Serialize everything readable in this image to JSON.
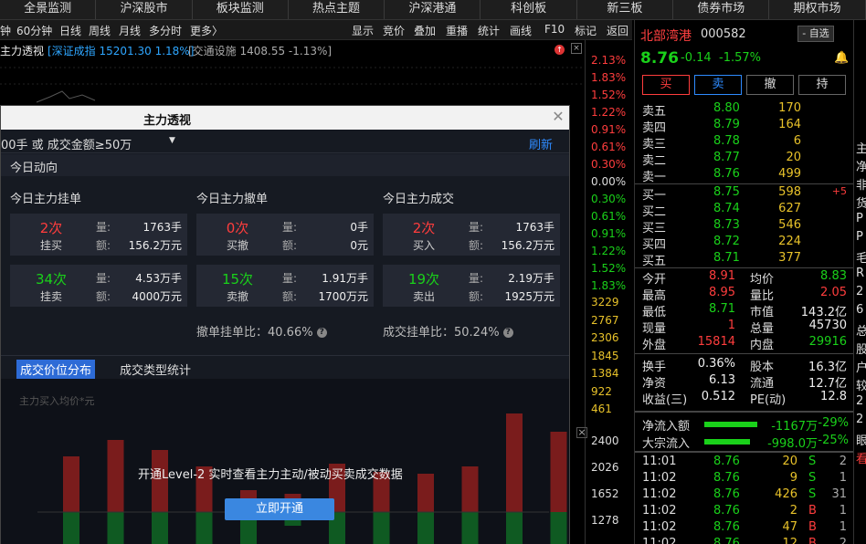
{
  "topnav": [
    "全景监测",
    "沪深股市",
    "板块监测",
    "热点主题",
    "沪深港通",
    "科创板",
    "新三板",
    "债券市场",
    "期权市场"
  ],
  "toolbar": {
    "periods": [
      "钟",
      "60分钟",
      "日线",
      "周线",
      "月线",
      "多分时",
      "更多〉"
    ],
    "tools": [
      "显示",
      "竞价",
      "叠加",
      "重播",
      "统计",
      "画线",
      "F10",
      "标记",
      "返回"
    ]
  },
  "chartinfo": {
    "title": "主力透视",
    "index": "[深证成指 15201.30 1.18%]",
    "sector": "[交通设施 1408.55 -1.13%]"
  },
  "rscale": {
    "pct_up": [
      "2.13%",
      "1.83%",
      "1.52%",
      "1.22%",
      "0.91%",
      "0.61%",
      "0.30%",
      "0.00%"
    ],
    "pct_dn": [
      "0.30%",
      "0.61%",
      "0.91%",
      "1.22%",
      "1.52%",
      "1.83%"
    ],
    "vol": [
      "3229",
      "2767",
      "2306",
      "1845",
      "1384",
      "922",
      "461"
    ],
    "lower": [
      "2400",
      "2026",
      "1652",
      "1278"
    ],
    "close_mark": "×"
  },
  "stock": {
    "name": "北部湾港",
    "code": "000582",
    "selfsel": "- 自选",
    "price": "8.76",
    "chg": "-0.14",
    "chgpct": "-1.57%",
    "buttons": [
      "买",
      "卖",
      "撤",
      "持"
    ],
    "sells": [
      {
        "l": "卖五",
        "p": "8.80",
        "v": "170"
      },
      {
        "l": "卖四",
        "p": "8.79",
        "v": "164"
      },
      {
        "l": "卖三",
        "p": "8.78",
        "v": "6"
      },
      {
        "l": "卖二",
        "p": "8.77",
        "v": "20"
      },
      {
        "l": "卖一",
        "p": "8.76",
        "v": "499"
      }
    ],
    "buys": [
      {
        "l": "买一",
        "p": "8.75",
        "v": "598",
        "x": "+5"
      },
      {
        "l": "买二",
        "p": "8.74",
        "v": "627",
        "x": ""
      },
      {
        "l": "买三",
        "p": "8.73",
        "v": "546",
        "x": ""
      },
      {
        "l": "买四",
        "p": "8.72",
        "v": "224",
        "x": ""
      },
      {
        "l": "买五",
        "p": "8.71",
        "v": "377",
        "x": ""
      }
    ],
    "stats": [
      {
        "a": "今开",
        "b": "8.91",
        "c": "均价",
        "d": "8.83"
      },
      {
        "a": "最高",
        "b": "8.95",
        "c": "量比",
        "d": "2.05"
      },
      {
        "a": "最低",
        "b": "8.71",
        "c": "市值",
        "d": "143.2亿"
      },
      {
        "a": "现量",
        "b": "1",
        "c": "总量",
        "d": "45730"
      },
      {
        "a": "外盘",
        "b": "15814",
        "c": "内盘",
        "d": "29916"
      }
    ],
    "stats2": [
      {
        "a": "换手",
        "b": "0.36%",
        "c": "股本",
        "d": "16.3亿"
      },
      {
        "a": "净资",
        "b": "6.13",
        "c": "流通",
        "d": "12.7亿"
      },
      {
        "a": "收益(三)",
        "b": "0.512",
        "c": "PE(动)",
        "d": "12.8"
      }
    ],
    "flows": [
      {
        "l": "净流入额",
        "v": "-1167万",
        "p": "-29%",
        "fill": 0.29
      },
      {
        "l": "大宗流入",
        "v": "-998.0万",
        "p": "-25%",
        "fill": 0.25
      }
    ],
    "ticks": [
      {
        "t": "11:01",
        "p": "8.76",
        "v": "20",
        "s": "S",
        "n": "2"
      },
      {
        "t": "11:02",
        "p": "8.76",
        "v": "9",
        "s": "S",
        "n": "1"
      },
      {
        "t": "11:02",
        "p": "8.76",
        "v": "426",
        "s": "S",
        "n": "31"
      },
      {
        "t": "11:02",
        "p": "8.76",
        "v": "2",
        "s": "B",
        "n": "1"
      },
      {
        "t": "11:02",
        "p": "8.76",
        "v": "47",
        "s": "B",
        "n": "1"
      },
      {
        "t": "11:02",
        "p": "8.76",
        "v": "12",
        "s": "B",
        "n": "2"
      }
    ]
  },
  "farright": [
    "主",
    "净",
    "非",
    "货",
    "P",
    "P",
    "毛",
    "R",
    "2",
    "6",
    "总",
    "股",
    "户",
    "较",
    "2",
    "2",
    "眼",
    "看"
  ],
  "modal": {
    "title": "主力透视",
    "filter": "00手 或 成交金额≥50万",
    "refresh": "刷新",
    "section": "今日动向",
    "groups": [
      {
        "head": "今日主力挂单",
        "cards": [
          {
            "big": "2次",
            "sm": "挂买",
            "q": "1763手",
            "a": "156.2万元",
            "c": "red"
          },
          {
            "big": "34次",
            "sm": "挂卖",
            "q": "4.53万手",
            "a": "4000万元",
            "c": "green"
          }
        ]
      },
      {
        "head": "今日主力撤单",
        "cards": [
          {
            "big": "0次",
            "sm": "买撤",
            "q": "0手",
            "a": "0元",
            "c": "red"
          },
          {
            "big": "15次",
            "sm": "卖撤",
            "q": "1.91万手",
            "a": "1700万元",
            "c": "green"
          }
        ]
      },
      {
        "head": "今日主力成交",
        "cards": [
          {
            "big": "2次",
            "sm": "买入",
            "q": "1763手",
            "a": "156.2万元",
            "c": "red"
          },
          {
            "big": "19次",
            "sm": "卖出",
            "q": "2.19万手",
            "a": "1925万元",
            "c": "green"
          }
        ]
      }
    ],
    "qlabel": "量:",
    "alabel": "额:",
    "ratio1": "撤单挂单比：40.66%",
    "ratio2": "成交挂单比：50.24%",
    "tabs": [
      "成交价位分布",
      "成交类型统计"
    ],
    "chartlabel": "主力买入均价*元",
    "overlay": "开通Level-2 实时查看主力主动/被动买卖成交数据",
    "cta": "立即开通",
    "bars": [
      {
        "up": 0.55,
        "dn": 0.32
      },
      {
        "up": 0.72,
        "dn": 0.32
      },
      {
        "up": 0.62,
        "dn": 0.32
      },
      {
        "up": 0.45,
        "dn": 0.32
      },
      {
        "up": 0.22,
        "dn": 0.32
      },
      {
        "up": 0.18,
        "dn": 0.14
      },
      {
        "up": 0.48,
        "dn": 0.32
      },
      {
        "up": 0.4,
        "dn": 0.32
      },
      {
        "up": 0.38,
        "dn": 0.32
      },
      {
        "up": 0.45,
        "dn": 0.32
      },
      {
        "up": 0.98,
        "dn": 0.32
      },
      {
        "up": 0.8,
        "dn": 0.32
      }
    ]
  }
}
